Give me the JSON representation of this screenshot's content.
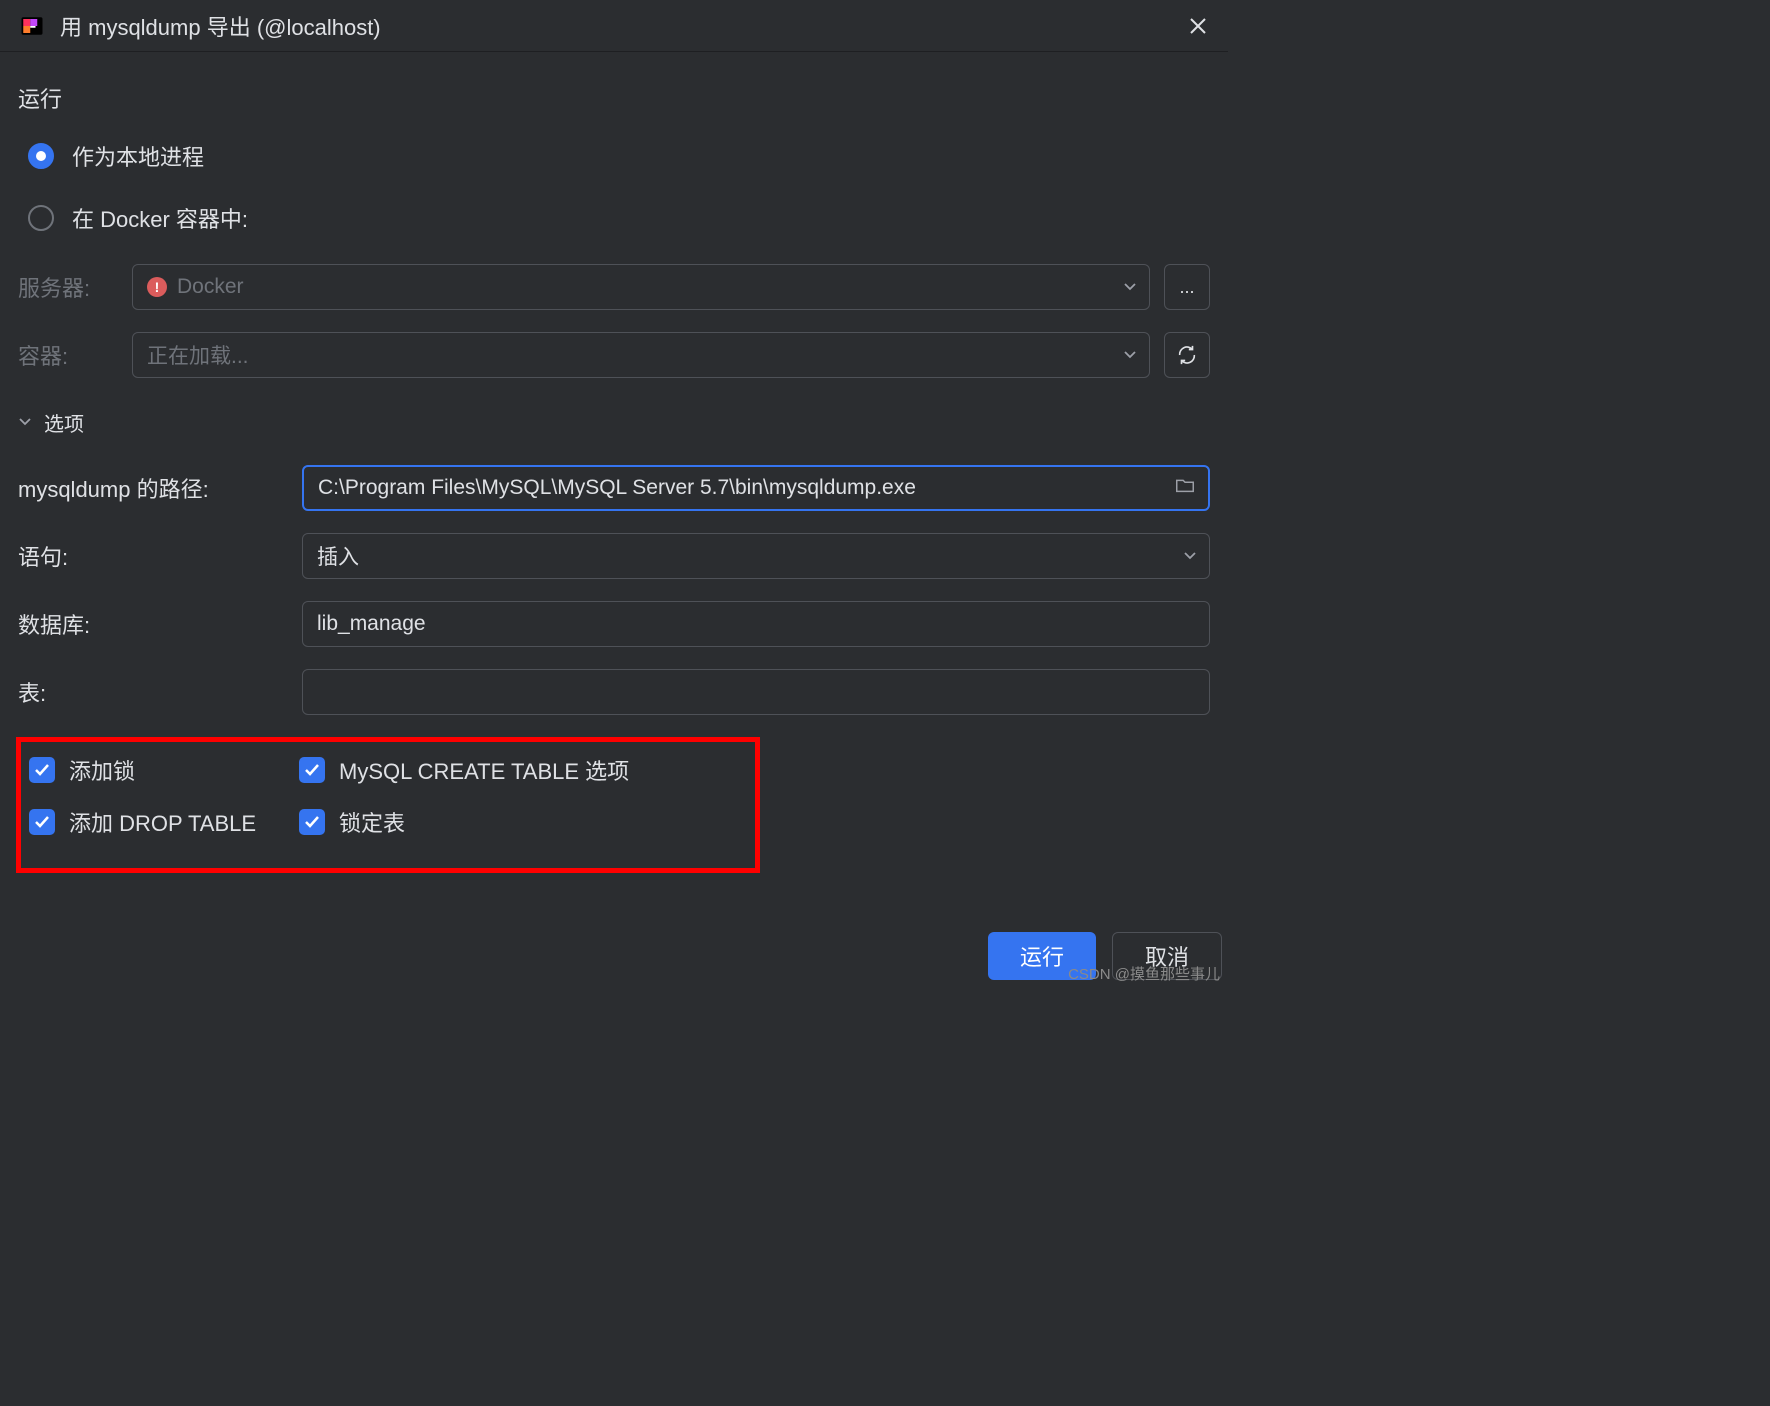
{
  "dialog": {
    "title": "用 mysqldump 导出 (@localhost)"
  },
  "run": {
    "section_label": "运行",
    "local_process_label": "作为本地进程",
    "docker_container_label": "在 Docker 容器中:"
  },
  "server": {
    "label": "服务器:",
    "value": "Docker",
    "more_label": "..."
  },
  "container": {
    "label": "容器:",
    "value": "正在加载..."
  },
  "options": {
    "section_label": "选项"
  },
  "path": {
    "label": "mysqldump 的路径:",
    "value": "C:\\Program Files\\MySQL\\MySQL Server 5.7\\bin\\mysqldump.exe"
  },
  "statement": {
    "label": "语句:",
    "value": "插入"
  },
  "database": {
    "label": "数据库:",
    "value": "lib_manage"
  },
  "table": {
    "label": "表:",
    "value": ""
  },
  "checkboxes": {
    "add_lock": "添加锁",
    "mysql_create_table": "MySQL CREATE TABLE 选项",
    "add_drop_table": "添加 DROP TABLE",
    "lock_tables": "锁定表"
  },
  "buttons": {
    "run": "运行",
    "cancel": "取消"
  },
  "watermark": "CSDN @摸鱼那些事儿"
}
